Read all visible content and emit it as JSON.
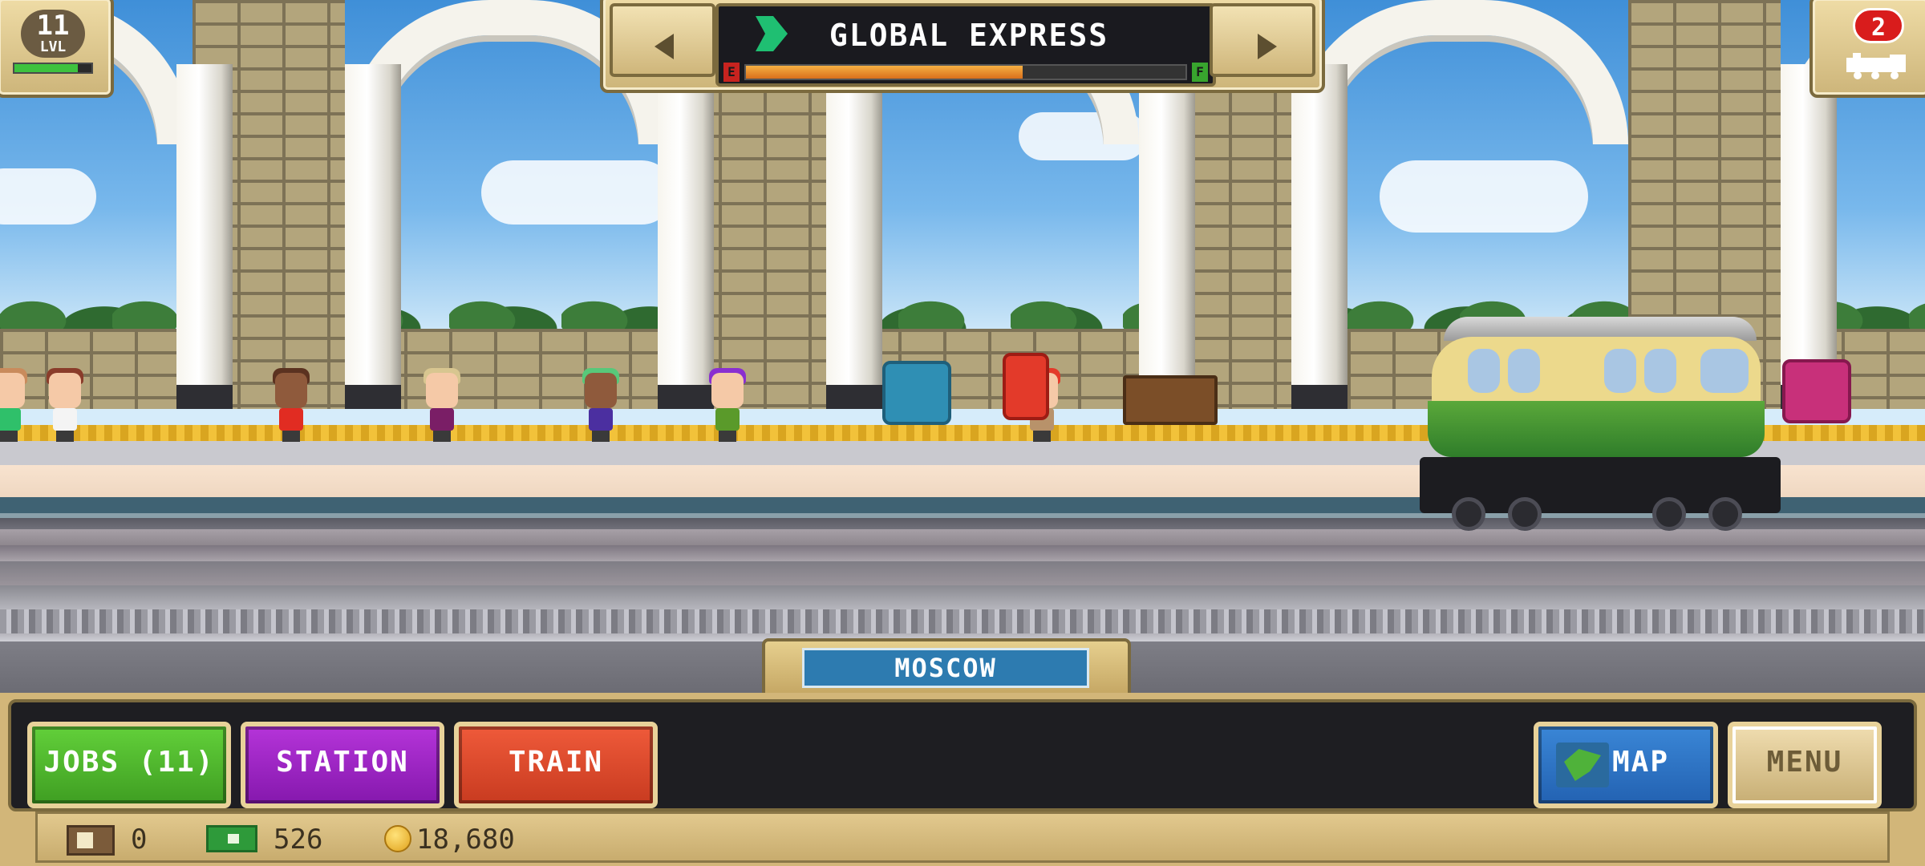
{
  "hud": {
    "level": {
      "number": "11",
      "label": "LVL",
      "xp_fraction": 0.82
    },
    "trains_count": "2",
    "train_name": "GLOBAL EXPRESS",
    "fuel": {
      "empty_label": "E",
      "full_label": "F",
      "fraction": 0.63
    },
    "station_name": "MOSCOW"
  },
  "buttons": {
    "jobs": "JOBS (11)",
    "station": "STATION",
    "train": "TRAIN",
    "map": "MAP",
    "menu": "MENU"
  },
  "currency": {
    "tickets": "0",
    "cash": "526",
    "coins": "18,680"
  },
  "colors": {
    "jobs": "#4fb42c",
    "station": "#9d22c4",
    "train": "#e04a2c",
    "map": "#2e74c4",
    "station_plate": "#2d7bb0"
  },
  "icons": [
    "train-arrow-icon",
    "ticket-icon",
    "cash-icon",
    "coin-icon",
    "map-icon",
    "locomotive-icon"
  ]
}
